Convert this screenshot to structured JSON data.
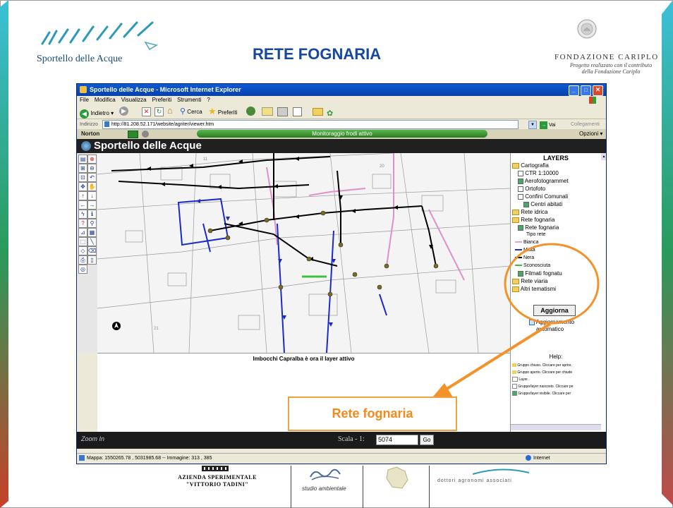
{
  "slide": {
    "title": "RETE FOGNARIA",
    "logo_left_text": "Sportello delle Acque",
    "fondazione_title": "FONDAZIONE CARIPLO",
    "fondazione_subtitle_line1": "Progetto realizzato con il contributo",
    "fondazione_subtitle_line2": "della Fondazione Cariplo",
    "callout_label": "Rete fognaria",
    "colors": {
      "title": "#1648a0",
      "callout": "#f28a1e",
      "stripe_teal": "#3cb0c8",
      "stripe_red": "#c04a4a"
    }
  },
  "ie": {
    "window_title": "Sportello delle Acque - Microsoft Internet Explorer",
    "menu": [
      "File",
      "Modifica",
      "Visualizza",
      "Preferiti",
      "Strumenti",
      "?"
    ],
    "toolbar": {
      "back": "Indietro",
      "search": "Cerca",
      "favorites": "Preferiti"
    },
    "address_label": "Indirizzo",
    "address_value": "http://81.208.52.171/website/agriter/viewer.htm",
    "go_label": "Vai",
    "links_label": "Collegamenti",
    "norton_label": "Norton",
    "norton_status": "Monitoraggio frodi attivo",
    "options_label": "Opzioni",
    "status_left": "Mappa: 1550265.78 , 5031985.68 -- Immagine: 313 , 385",
    "status_right": "Internet"
  },
  "app": {
    "header_title": "Sportello delle Acque",
    "info_text": "Imbocchi Capralba è ora il layer attivo",
    "zoom_label": "Zoom In",
    "scale_label": "Scala - 1:",
    "scale_value": "5074",
    "scale_go": "Go"
  },
  "layers": {
    "header": "LAYERS",
    "items": [
      "Cartografia",
      "CTR 1:10000",
      "Aerofotogrammet",
      "Ortofoto",
      "Confini Comunali",
      "Centri abitati",
      "Rete idrica",
      "Rete fognaria",
      "Rete fognaria",
      "Tipo rete",
      "Bianca",
      "Mista",
      "Nera",
      "Sconosciuta",
      "Filmati fognatu",
      "Rete viaria",
      "Altri tematismi"
    ],
    "legend_colors": {
      "bianca": "#f0a0d0",
      "mista": "#2030c0",
      "nera": "#000000",
      "sconosciuta": "#40c040"
    },
    "update_button": "Aggiorna",
    "auto_update_line1": "Aggiornamento",
    "auto_update_line2": "automatico",
    "help_title": "Help:",
    "help_items": [
      "Gruppo chiuso. Cliccare per aprire.",
      "Gruppo aperto. Cliccare per chiude",
      "Layer.",
      "Gruppo/layer nascosto. Cliccare pe",
      "Gruppo/layer visibile. Cliccare per"
    ]
  },
  "partners": {
    "azienda_line1": "AZIENDA SPERIMENTALE",
    "azienda_line2": "\"VITTORIO TADINI\"",
    "studio": "studio ambientale",
    "dottori": "dottori agronomi associati"
  }
}
